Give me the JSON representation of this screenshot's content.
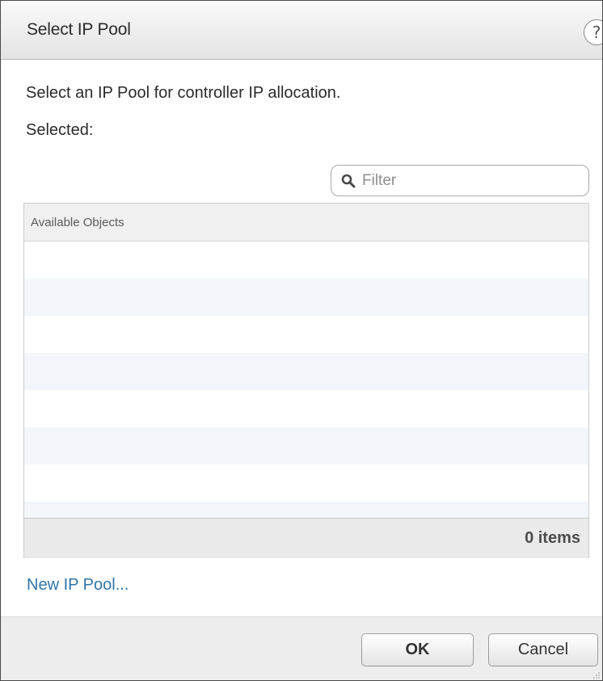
{
  "dialog": {
    "title": "Select IP Pool",
    "help_icon": "?",
    "description": "Select an IP Pool for controller IP allocation.",
    "selected_label": "Selected:"
  },
  "filter": {
    "placeholder": "Filter",
    "value": "",
    "icon": "search-icon"
  },
  "grid": {
    "column_header": "Available Objects",
    "rows": [],
    "item_count": "0 items"
  },
  "links": {
    "new_pool": "New IP Pool..."
  },
  "buttons": {
    "ok": "OK",
    "cancel": "Cancel"
  },
  "colors": {
    "link": "#3174a5",
    "titlebar": "#e3e3e3",
    "alt_row": "#f2f6fa",
    "footer": "#eaeaea"
  }
}
